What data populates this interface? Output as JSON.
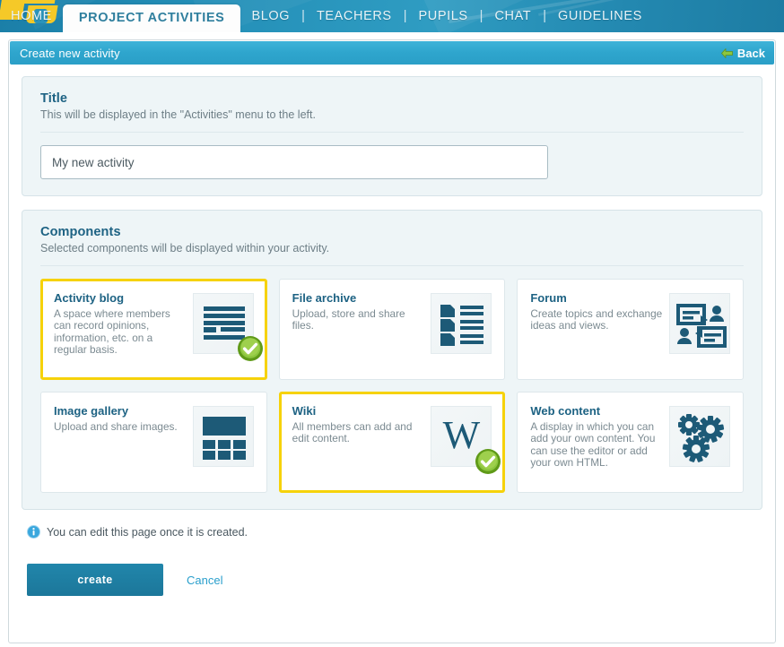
{
  "nav": {
    "logo_icon": "site-logo",
    "items": [
      {
        "label": "HOME",
        "active": false
      },
      {
        "label": "PROJECT ACTIVITIES",
        "active": true
      },
      {
        "label": "BLOG",
        "active": false
      },
      {
        "label": "TEACHERS",
        "active": false
      },
      {
        "label": "PUPILS",
        "active": false
      },
      {
        "label": "CHAT",
        "active": false
      },
      {
        "label": "GUIDELINES",
        "active": false
      }
    ],
    "separator": "|"
  },
  "header_bar": {
    "title": "Create new activity",
    "back_label": "Back",
    "back_icon": "arrow-left-icon",
    "background_color": "#2ea5cd"
  },
  "title_panel": {
    "heading": "Title",
    "subtext": "This will be displayed in the \"Activities\" menu to the left.",
    "input_value": "My new activity",
    "input_placeholder": "My new activity"
  },
  "components_panel": {
    "heading": "Components",
    "subtext": "Selected components will be displayed within your activity.",
    "selected_border_color": "#f6d20a",
    "check_color": "#7ac143",
    "cards": [
      {
        "title": "Activity blog",
        "description": "A space where members can record opinions, information, etc. on a regular basis.",
        "icon": "blog-lines-icon",
        "selected": true
      },
      {
        "title": "File archive",
        "description": "Upload, store and share files.",
        "icon": "file-list-icon",
        "selected": false
      },
      {
        "title": "Forum",
        "description": "Create topics and exchange ideas and views.",
        "icon": "forum-speech-people-icon",
        "selected": false
      },
      {
        "title": "Image gallery",
        "description": "Upload and share images.",
        "icon": "image-grid-icon",
        "selected": false
      },
      {
        "title": "Wiki",
        "description": "All members can add and edit content.",
        "icon": "wiki-w-icon",
        "selected": true
      },
      {
        "title": "Web content",
        "description": "A display in which you can add your own content. You can use the editor or add your own HTML.",
        "icon": "gears-icon",
        "selected": false
      }
    ]
  },
  "footer": {
    "note_icon": "info-icon",
    "note": "You can edit this page once it is created.",
    "create_label": "create",
    "cancel_label": "Cancel",
    "create_color": "#1c779a",
    "cancel_color": "#2a9fcc"
  }
}
